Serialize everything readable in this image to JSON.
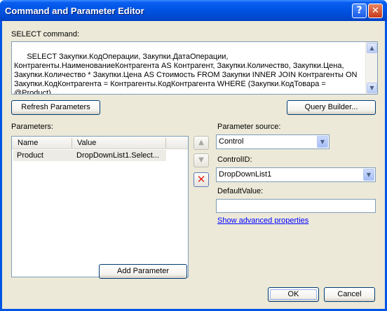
{
  "window": {
    "title": "Command and Parameter Editor",
    "help_glyph": "?",
    "close_glyph": "✕"
  },
  "select_command": {
    "label": "SELECT command:",
    "text": "SELECT Закупки.КодОперации, Закупки.ДатаОперации, Контрагенты.НаименованиеКонтрагента AS Контрагент, Закупки.Количество, Закупки.Цена, Закупки.Количество * Закупки.Цена AS Стоимость FROM Закупки INNER JOIN Контрагенты ON Закупки.КодКонтрагента = Контрагенты.КодКонтрагента WHERE (Закупки.КодТовара = @Product)"
  },
  "buttons": {
    "refresh": "Refresh Parameters",
    "query_builder": "Query Builder...",
    "add_parameter": "Add Parameter",
    "ok": "OK",
    "cancel": "Cancel"
  },
  "parameters": {
    "label": "Parameters:",
    "columns": [
      "Name",
      "Value"
    ],
    "rows": [
      {
        "name": "Product",
        "value": "DropDownList1.Select..."
      }
    ]
  },
  "parameter_source": {
    "label": "Parameter source:",
    "value": "Control"
  },
  "control_id": {
    "label": "ControlID:",
    "value": "DropDownList1"
  },
  "default_value": {
    "label": "DefaultValue:",
    "value": ""
  },
  "advanced_link": "Show advanced properties",
  "icons": {
    "move_up": "▲",
    "move_down": "▼",
    "delete": "✕",
    "scroll_up": "▲",
    "scroll_down": "▼",
    "dropdown": "▼"
  },
  "colors": {
    "titlebar": "#0054e3",
    "dialog_bg": "#ece9d8",
    "link": "#0000ff",
    "delete_icon": "#e1271c"
  }
}
